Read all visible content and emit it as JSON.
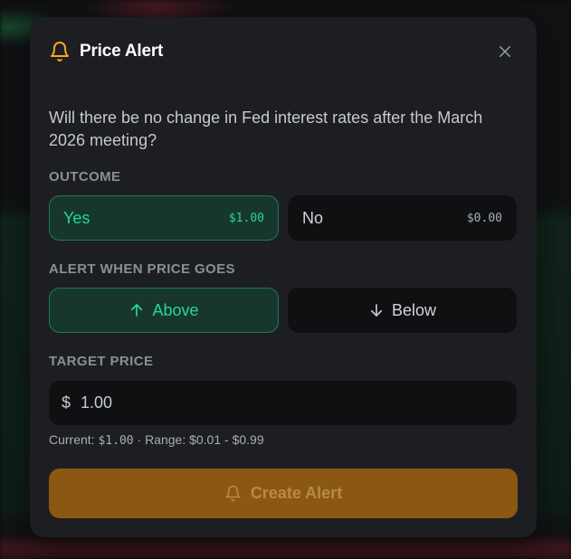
{
  "backdrop": {},
  "modal": {
    "title": "Price Alert",
    "question": "Will there be no change in Fed interest rates after the March 2026 meeting?",
    "outcome": {
      "label": "OUTCOME",
      "options": [
        {
          "label": "Yes",
          "price": "$1.00",
          "selected": true
        },
        {
          "label": "No",
          "price": "$0.00",
          "selected": false
        }
      ]
    },
    "direction": {
      "label": "ALERT WHEN PRICE GOES",
      "options": [
        {
          "label": "Above",
          "icon": "arrow-up-icon",
          "selected": true
        },
        {
          "label": "Below",
          "icon": "arrow-down-icon",
          "selected": false
        }
      ]
    },
    "target": {
      "label": "TARGET PRICE",
      "currency": "$",
      "value": "1.00"
    },
    "helper": {
      "current_label": "Current:",
      "current_value": "$1.00",
      "separator": "·",
      "range_text": "Range: $0.01 - $0.99"
    },
    "create_button": {
      "label": "Create Alert",
      "icon": "bell-icon"
    }
  },
  "colors": {
    "accent_green": "#25d894",
    "accent_orange": "#f5a623",
    "button_bg": "#8a5813",
    "modal_bg": "#1d1e22"
  }
}
